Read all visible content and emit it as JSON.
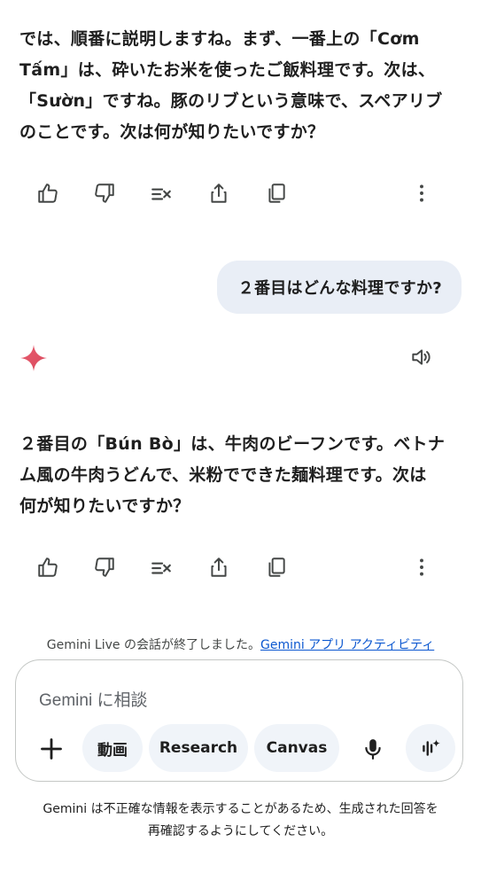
{
  "conversation": {
    "assistant_message_1": "では、順番に説明しますね。まず、一番上の「Cơm\nTấm」は、砕いたお米を使ったご飯料理です。次は、\n「Sườn」ですね。豚のリブという意味で、スペアリブ\nのことです。次は何が知りたいですか？",
    "user_message": "２番目はどんな料理ですか?",
    "assistant_message_2": "２番目の「Bún Bò」は、牛肉のビーフンです。ベトナ\nム風の牛肉うどんで、米粉でできた麺料理です。次は\n何が知りたいですか？"
  },
  "actions": [
    "thumbs-up",
    "thumbs-down",
    "modify-response",
    "share",
    "copy",
    "more"
  ],
  "live_ended": {
    "text": "Gemini Live の会話が終了しました。",
    "link": "Gemini アプリ アクティビティ"
  },
  "composer": {
    "placeholder": "Gemini に相談",
    "chips": [
      "動画",
      "Research",
      "Canvas"
    ]
  },
  "disclaimer": "Gemini は不正確な情報を表示することがあるため、生成された回答を\n再確認するようにしてください。",
  "colors": {
    "bubble": "#e9eef6",
    "chip": "#f0f4f9",
    "link": "#0b57d0",
    "spark": "#e05a6a"
  }
}
